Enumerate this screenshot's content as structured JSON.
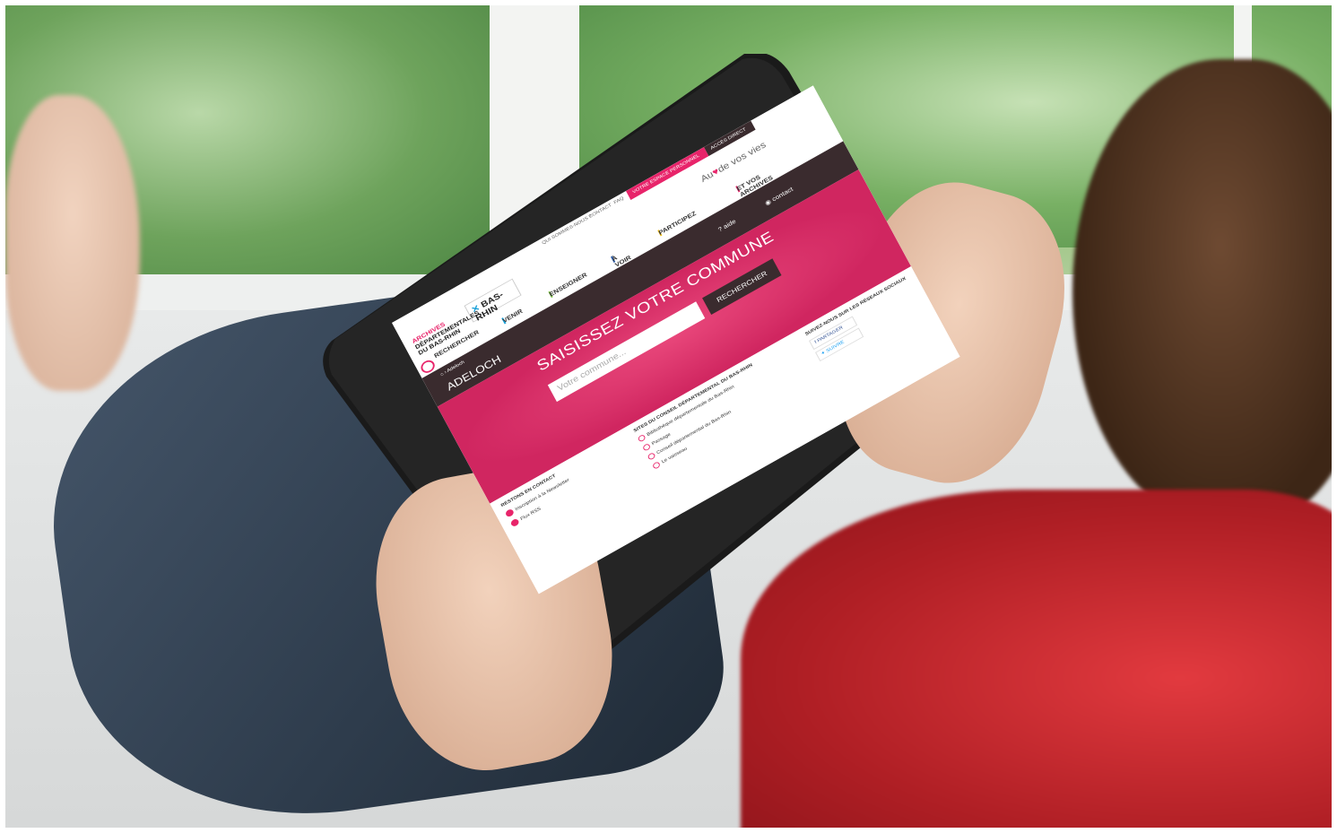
{
  "screen": {
    "topbar": {
      "links": [
        "QUI SOMMES-NOUS ?",
        "CONTACT",
        "FAQ"
      ],
      "espace": "VOTRE ESPACE PERSONNEL",
      "acces": "ACCÈS DIRECT"
    },
    "logo": {
      "line1": "ARCHIVES",
      "line2": "DÉPARTEMENTALES",
      "line3": "DU BAS-RHIN",
      "partner": "BAS-RHIN"
    },
    "tagline": {
      "prefix": "Au",
      "suffix": "de vos vies",
      "sub": "ET VOS ARCHIVES ?"
    },
    "nav": {
      "recherche": "RECHERCHER",
      "items": [
        "VENIR",
        "ENSEIGNER",
        "À VOIR",
        "PARTICIPEZ"
      ]
    },
    "breadcrumb": "› Adeloch",
    "page_title": "ADELOCH",
    "aide": "aide",
    "contact": "contact",
    "hero": {
      "heading": "SAISISSEZ VOTRE COMMUNE",
      "placeholder": "Votre commune...",
      "button": "RECHERCHER"
    },
    "footer": {
      "contact_heading": "RESTONS EN CONTACT",
      "newsletter": "Inscription à la Newsletter",
      "rss": "Flux RSS",
      "sites_heading": "SITES DU CONSEIL DÉPARTEMENTAL DU BAS-RHIN",
      "sites": [
        "Bibliothèque départementale du Bas-Rhin",
        "Passage",
        "Conseil départemental du Bas-Rhin",
        "Le vaisseau"
      ],
      "social_heading": "SUIVEZ-NOUS SUR LES RÉSEAUX SOCIAUX",
      "partager": "PARTAGER",
      "suivre": "SUIVRE"
    }
  },
  "colors": {
    "accent": "#e8246a",
    "dark": "#3a2b2e",
    "shirt": "#c8262c"
  }
}
